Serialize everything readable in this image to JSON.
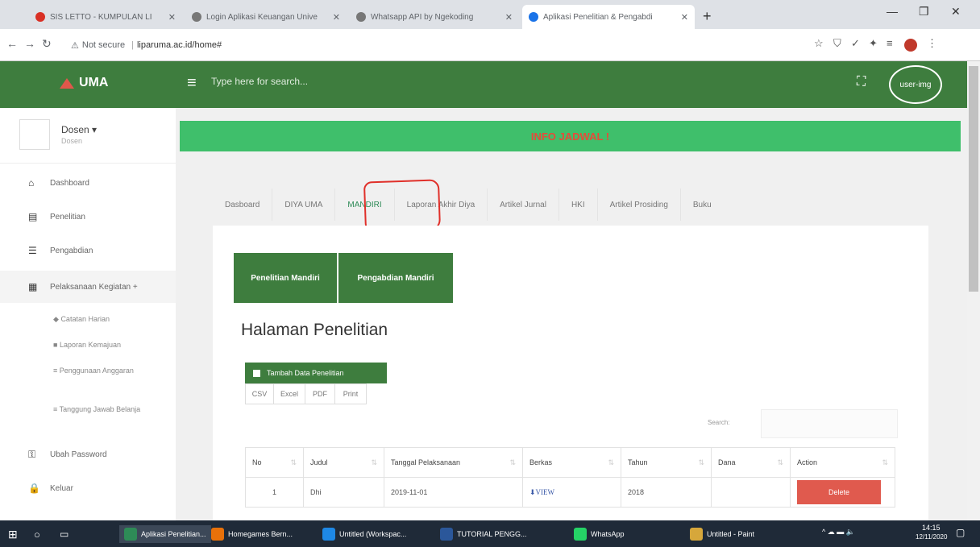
{
  "browser": {
    "tabs": [
      {
        "label": "SIS LETTO - KUMPULAN LI",
        "color": "#d93025"
      },
      {
        "label": "Login Aplikasi Keuangan Unive",
        "color": "#5f6368"
      },
      {
        "label": "Whatsapp API by Ngekoding",
        "color": "#5f6368"
      },
      {
        "label": "Aplikasi Penelitian & Pengabdi",
        "color": "#1a73e8"
      }
    ],
    "new_tab": "+",
    "url_prefix": "Not secure",
    "url": "liparuma.ac.id/home#"
  },
  "header": {
    "logo_text": "UMA",
    "search_placeholder": "Type here for search...",
    "avatar_text": "user-img"
  },
  "sidebar": {
    "user_name": "Dosen",
    "user_role": "Dosen",
    "items": [
      {
        "label": "Dashboard",
        "icon": "home-icon"
      },
      {
        "label": "Penelitian",
        "icon": "book-icon"
      },
      {
        "label": "Pengabdian",
        "icon": "list-icon"
      },
      {
        "label": "Pelaksanaan Kegiatan +",
        "icon": "grid-icon"
      }
    ],
    "subitems": [
      {
        "label": "Catatan Harian",
        "prefix": "◆"
      },
      {
        "label": "Laporan Kemajuan",
        "prefix": "■"
      },
      {
        "label": "Penggunaan Anggaran",
        "prefix": "≡"
      },
      {
        "label": "Tanggung Jawab Belanja",
        "prefix": "≡"
      }
    ],
    "bottom_items": [
      {
        "label": "Ubah Password",
        "icon": "key-icon"
      },
      {
        "label": "Keluar",
        "icon": "lock-icon"
      }
    ]
  },
  "main": {
    "info": "INFO JADWAL !",
    "tabs": [
      "Dasboard",
      "DIYA UMA",
      "MANDIRI",
      "Laporan Akhir Diya",
      "Artikel Jurnal",
      "HKI",
      "Artikel Prosiding",
      "Buku"
    ],
    "active_tab": "MANDIRI",
    "sub_buttons": [
      "Penelitian Mandiri",
      "Pengabdian Mandiri"
    ],
    "page_title": "Halaman Penelitian",
    "add_button": "Tambah Data Penelitian",
    "export_buttons": [
      "CSV",
      "Excel",
      "PDF",
      "Print"
    ],
    "search_label": "Search:",
    "table": {
      "headers": [
        "No",
        "Judul",
        "Tanggal Pelaksanaan",
        "Berkas",
        "Tahun",
        "Dana",
        "Action"
      ],
      "rows": [
        {
          "no": "1",
          "judul": "Dhi",
          "tanggal": "2019-11-01",
          "berkas": "VIEW",
          "tahun": "2018",
          "dana": "",
          "action": "Delete"
        }
      ]
    }
  },
  "taskbar": {
    "items": [
      "Aplikasi Penelitian...",
      "Homegames Bern...",
      "Untitled (Workspac...",
      "TUTORIAL PENGG...",
      "WhatsApp",
      "Untitled - Paint"
    ],
    "time": "14:15",
    "date": "12/11/2020"
  }
}
